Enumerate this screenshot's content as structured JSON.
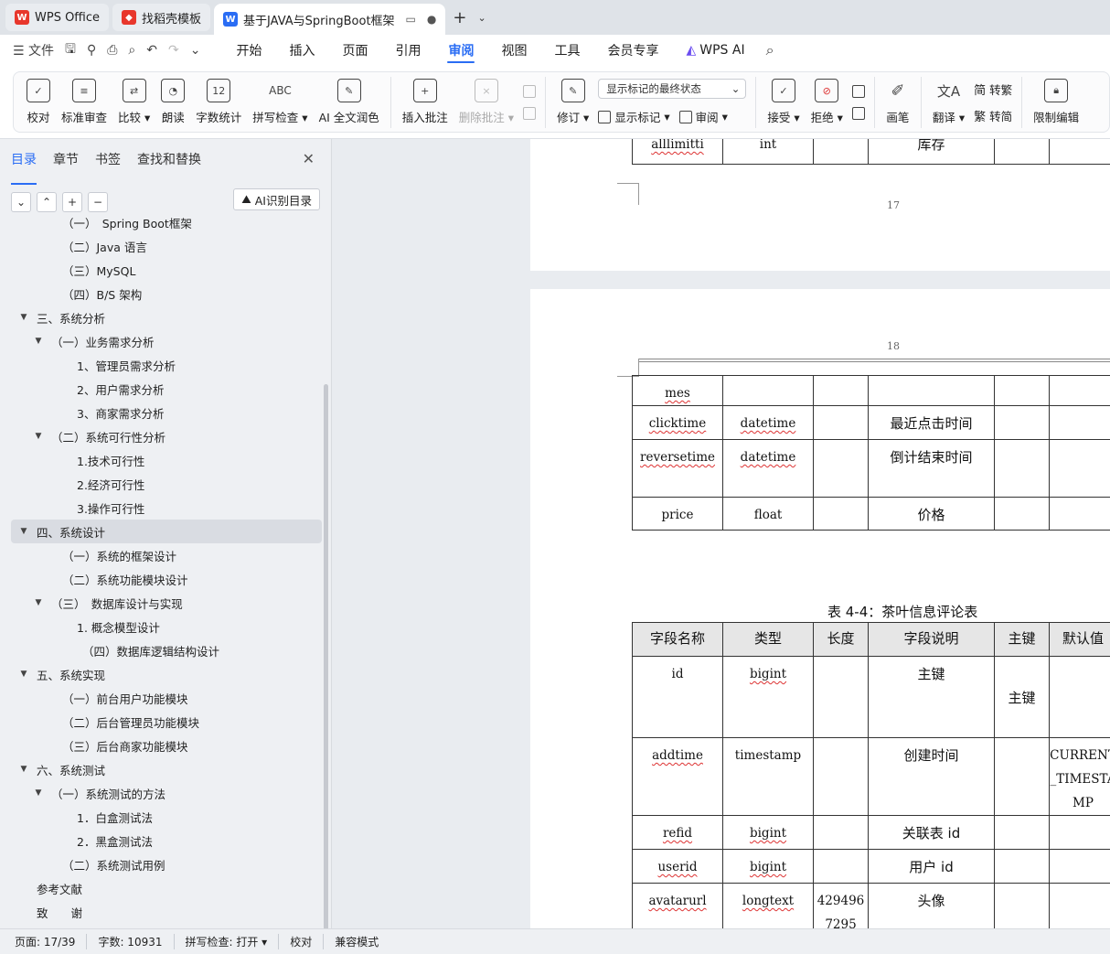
{
  "tabs": [
    {
      "label": "WPS Office",
      "icon": "wps-logo-icon"
    },
    {
      "label": "找稻壳模板",
      "icon": "docer-icon"
    },
    {
      "label": "基于JAVA与SpringBoot框架",
      "icon": "writer-doc-icon"
    }
  ],
  "menu": {
    "file": "文件",
    "items": [
      "开始",
      "插入",
      "页面",
      "引用",
      "审阅",
      "视图",
      "工具",
      "会员专享",
      "WPS AI"
    ],
    "active": "审阅"
  },
  "ribbon": {
    "proofread": "校对",
    "standard_review": "标准审查",
    "compare": "比较",
    "read_aloud": "朗读",
    "word_count": "字数统计",
    "spell_check": "拼写检查",
    "ai_polish": "AI 全文润色",
    "insert_comment": "插入批注",
    "delete_comment": "删除批注",
    "revise": "修订",
    "markup_combo": "显示标记的最终状态",
    "show_markup": "显示标记",
    "review": "审阅",
    "accept": "接受",
    "reject": "拒绝",
    "pen": "画笔",
    "translate": "翻译",
    "to_traditional": "转繁",
    "to_simplified": "转简",
    "restrict_edit": "限制编辑"
  },
  "sidebar": {
    "tabs": [
      "目录",
      "章节",
      "书签",
      "查找和替换"
    ],
    "active_tab": "目录",
    "ai_button": "AI识别目录",
    "toc": [
      {
        "label": "（一）　Spring Boot框架",
        "level": 2,
        "caret": ""
      },
      {
        "label": "（二）Java 语言",
        "level": 2,
        "caret": ""
      },
      {
        "label": "（三）MySQL",
        "level": 2,
        "caret": ""
      },
      {
        "label": "（四）B/S 架构",
        "level": 2,
        "caret": ""
      },
      {
        "label": "三、系统分析",
        "level": 1,
        "caret": "▼"
      },
      {
        "label": "（一）业务需求分析",
        "level": 2,
        "caret": "▼"
      },
      {
        "label": "1、管理员需求分析",
        "level": 3,
        "caret": ""
      },
      {
        "label": "2、用户需求分析",
        "level": 3,
        "caret": ""
      },
      {
        "label": "3、商家需求分析",
        "level": 3,
        "caret": ""
      },
      {
        "label": "（二）系统可行性分析",
        "level": 2,
        "caret": "▼"
      },
      {
        "label": "1.技术可行性",
        "level": 3,
        "caret": ""
      },
      {
        "label": "2.经济可行性",
        "level": 3,
        "caret": ""
      },
      {
        "label": "3.操作可行性",
        "level": 3,
        "caret": ""
      },
      {
        "label": "四、系统设计",
        "level": 1,
        "caret": "▼",
        "selected": true
      },
      {
        "label": "（一）系统的框架设计",
        "level": 2,
        "caret": ""
      },
      {
        "label": "（二）系统功能模块设计",
        "level": 2,
        "caret": ""
      },
      {
        "label": "（三）　数据库设计与实现",
        "level": 2,
        "caret": "▼"
      },
      {
        "label": "1. 概念模型设计",
        "level": 3,
        "caret": ""
      },
      {
        "label": "（四）数据库逻辑结构设计",
        "level": 3.3,
        "caret": ""
      },
      {
        "label": "五、系统实现",
        "level": 1,
        "caret": "▼"
      },
      {
        "label": "（一）前台用户功能模块",
        "level": 2,
        "caret": ""
      },
      {
        "label": "（二）后台管理员功能模块",
        "level": 2,
        "caret": ""
      },
      {
        "label": "（三）后台商家功能模块",
        "level": 2,
        "caret": ""
      },
      {
        "label": "六、系统测试",
        "level": 1,
        "caret": "▼"
      },
      {
        "label": "（一）系统测试的方法",
        "level": 2,
        "caret": "▼"
      },
      {
        "label": "1．白盒测试法",
        "level": 3,
        "caret": ""
      },
      {
        "label": "2．黑盒测试法",
        "level": 3,
        "caret": ""
      },
      {
        "label": "（二）系统测试用例",
        "level": 2,
        "caret": ""
      },
      {
        "label": "参考文献",
        "level": 1,
        "caret": ""
      },
      {
        "label": "致　　谢",
        "level": 1,
        "caret": ""
      }
    ]
  },
  "document": {
    "page17_number": "17",
    "page18_number": "18",
    "page17_row": [
      "alllimitti",
      "int",
      "",
      "库存",
      "",
      ""
    ],
    "table1_rows": [
      [
        "mes",
        "",
        "",
        "",
        "",
        ""
      ],
      [
        "clicktime",
        "datetime",
        "",
        "最近点击时间",
        "",
        ""
      ],
      [
        "reversetime",
        "datetime",
        "",
        "倒计结束时间",
        "",
        ""
      ],
      [
        "price",
        "float",
        "",
        "价格",
        "",
        ""
      ]
    ],
    "table2_caption": "表 4-4：茶叶信息评论表",
    "table2_header": [
      "字段名称",
      "类型",
      "长度",
      "字段说明",
      "主键",
      "默认值"
    ],
    "table2_rows": [
      [
        "id",
        "bigint",
        "",
        "主键",
        "主键",
        ""
      ],
      [
        "addtime",
        "timestamp",
        "",
        "创建时间",
        "",
        "CURRENT_TIMESTAMP"
      ],
      [
        "refid",
        "bigint",
        "",
        "关联表 id",
        "",
        ""
      ],
      [
        "userid",
        "bigint",
        "",
        "用户 id",
        "",
        ""
      ],
      [
        "avatarurl",
        "longtext",
        "4294967295",
        "头像",
        "",
        ""
      ]
    ]
  },
  "status": {
    "page": "页面: 17/39",
    "words": "字数: 10931",
    "spell": "拼写检查: 打开",
    "proof": "校对",
    "compat": "兼容模式"
  },
  "colors": {
    "accent": "#2a6df4",
    "spell_error": "#d33"
  }
}
